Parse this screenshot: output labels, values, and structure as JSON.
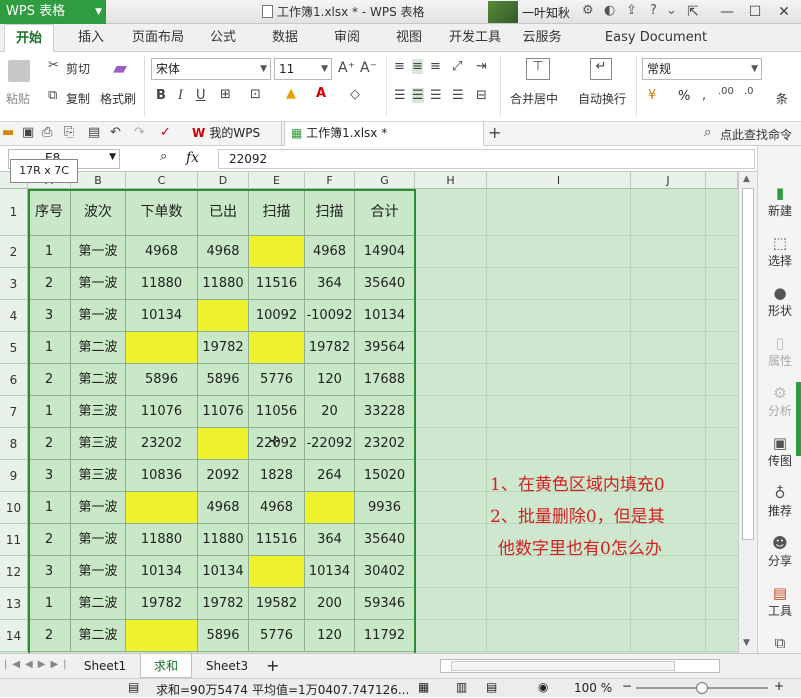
{
  "app": {
    "name": "WPS 表格",
    "doc_title": "工作簿1.xlsx * - WPS 表格",
    "user": "一叶知秋"
  },
  "ribbon_tabs": [
    "开始",
    "插入",
    "页面布局",
    "公式",
    "数据",
    "审阅",
    "视图",
    "开发工具",
    "云服务",
    "Easy Document Creator"
  ],
  "ribbon": {
    "paste": "粘贴",
    "cut": "剪切",
    "copy": "复制",
    "format_painter": "格式刷",
    "font_name": "宋体",
    "font_size": "11",
    "merge": "合并居中",
    "wrap": "自动换行",
    "number_format": "常规",
    "percent": "%",
    "conditional": "条"
  },
  "doc_tabs": [
    "我的WPS",
    "工作簿1.xlsx *"
  ],
  "find_cmd": "点此查找命令",
  "formula": {
    "name_box": "E8",
    "value": "22092",
    "fx": "fx"
  },
  "tooltip": "17R x 7C",
  "columns": [
    "A",
    "B",
    "C",
    "D",
    "E",
    "F",
    "G",
    "H",
    "I",
    "J"
  ],
  "rows": [
    "1",
    "2",
    "3",
    "4",
    "5",
    "6",
    "7",
    "8",
    "9",
    "10",
    "11",
    "12",
    "13",
    "14"
  ],
  "table": [
    {
      "cells": [
        "序号",
        "波次",
        "下单数",
        "已出",
        "扫描",
        "扫描",
        "合计"
      ],
      "yellow": []
    },
    {
      "cells": [
        "1",
        "第一波",
        "4968",
        "4968",
        "",
        "4968",
        "14904"
      ],
      "yellow": [
        4
      ]
    },
    {
      "cells": [
        "2",
        "第一波",
        "11880",
        "11880",
        "11516",
        "364",
        "35640"
      ],
      "yellow": []
    },
    {
      "cells": [
        "3",
        "第一波",
        "10134",
        "",
        "10092",
        "-10092",
        "10134"
      ],
      "yellow": [
        3
      ]
    },
    {
      "cells": [
        "1",
        "第二波",
        "",
        "19782",
        "",
        "19782",
        "39564"
      ],
      "yellow": [
        2,
        4
      ]
    },
    {
      "cells": [
        "2",
        "第二波",
        "5896",
        "5896",
        "5776",
        "120",
        "17688"
      ],
      "yellow": []
    },
    {
      "cells": [
        "1",
        "第三波",
        "11076",
        "11076",
        "11056",
        "20",
        "33228"
      ],
      "yellow": []
    },
    {
      "cells": [
        "2",
        "第三波",
        "23202",
        "",
        "22092",
        "-22092",
        "23202"
      ],
      "yellow": [
        3
      ]
    },
    {
      "cells": [
        "3",
        "第三波",
        "10836",
        "2092",
        "1828",
        "264",
        "15020"
      ],
      "yellow": []
    },
    {
      "cells": [
        "1",
        "第一波",
        "",
        "4968",
        "4968",
        "",
        "9936"
      ],
      "yellow": [
        2,
        5
      ]
    },
    {
      "cells": [
        "2",
        "第一波",
        "11880",
        "11880",
        "11516",
        "364",
        "35640"
      ],
      "yellow": []
    },
    {
      "cells": [
        "3",
        "第一波",
        "10134",
        "10134",
        "",
        "10134",
        "30402"
      ],
      "yellow": [
        4
      ]
    },
    {
      "cells": [
        "1",
        "第二波",
        "19782",
        "19782",
        "19582",
        "200",
        "59346"
      ],
      "yellow": []
    },
    {
      "cells": [
        "2",
        "第二波",
        "",
        "5896",
        "5776",
        "120",
        "11792"
      ],
      "yellow": [
        2
      ]
    }
  ],
  "note": [
    "1、在黄色区域内填充0",
    "2、批量删除0，但是其",
    "他数字里也有0怎么办"
  ],
  "side_panel": [
    "新建",
    "选择",
    "形状",
    "属性",
    "分析",
    "传图",
    "推荐",
    "分享",
    "工具",
    "备份"
  ],
  "sheets": [
    "Sheet1",
    "求和",
    "Sheet3"
  ],
  "status": {
    "sum": "求和=90万5474",
    "avg": "平均值=1万0407.747126...",
    "zoom": "100 %"
  },
  "colors": {
    "accent": "#2e9d3f",
    "cell_bg": "#c9e8c8",
    "yellow": "#eef22f",
    "note": "#d42020"
  }
}
